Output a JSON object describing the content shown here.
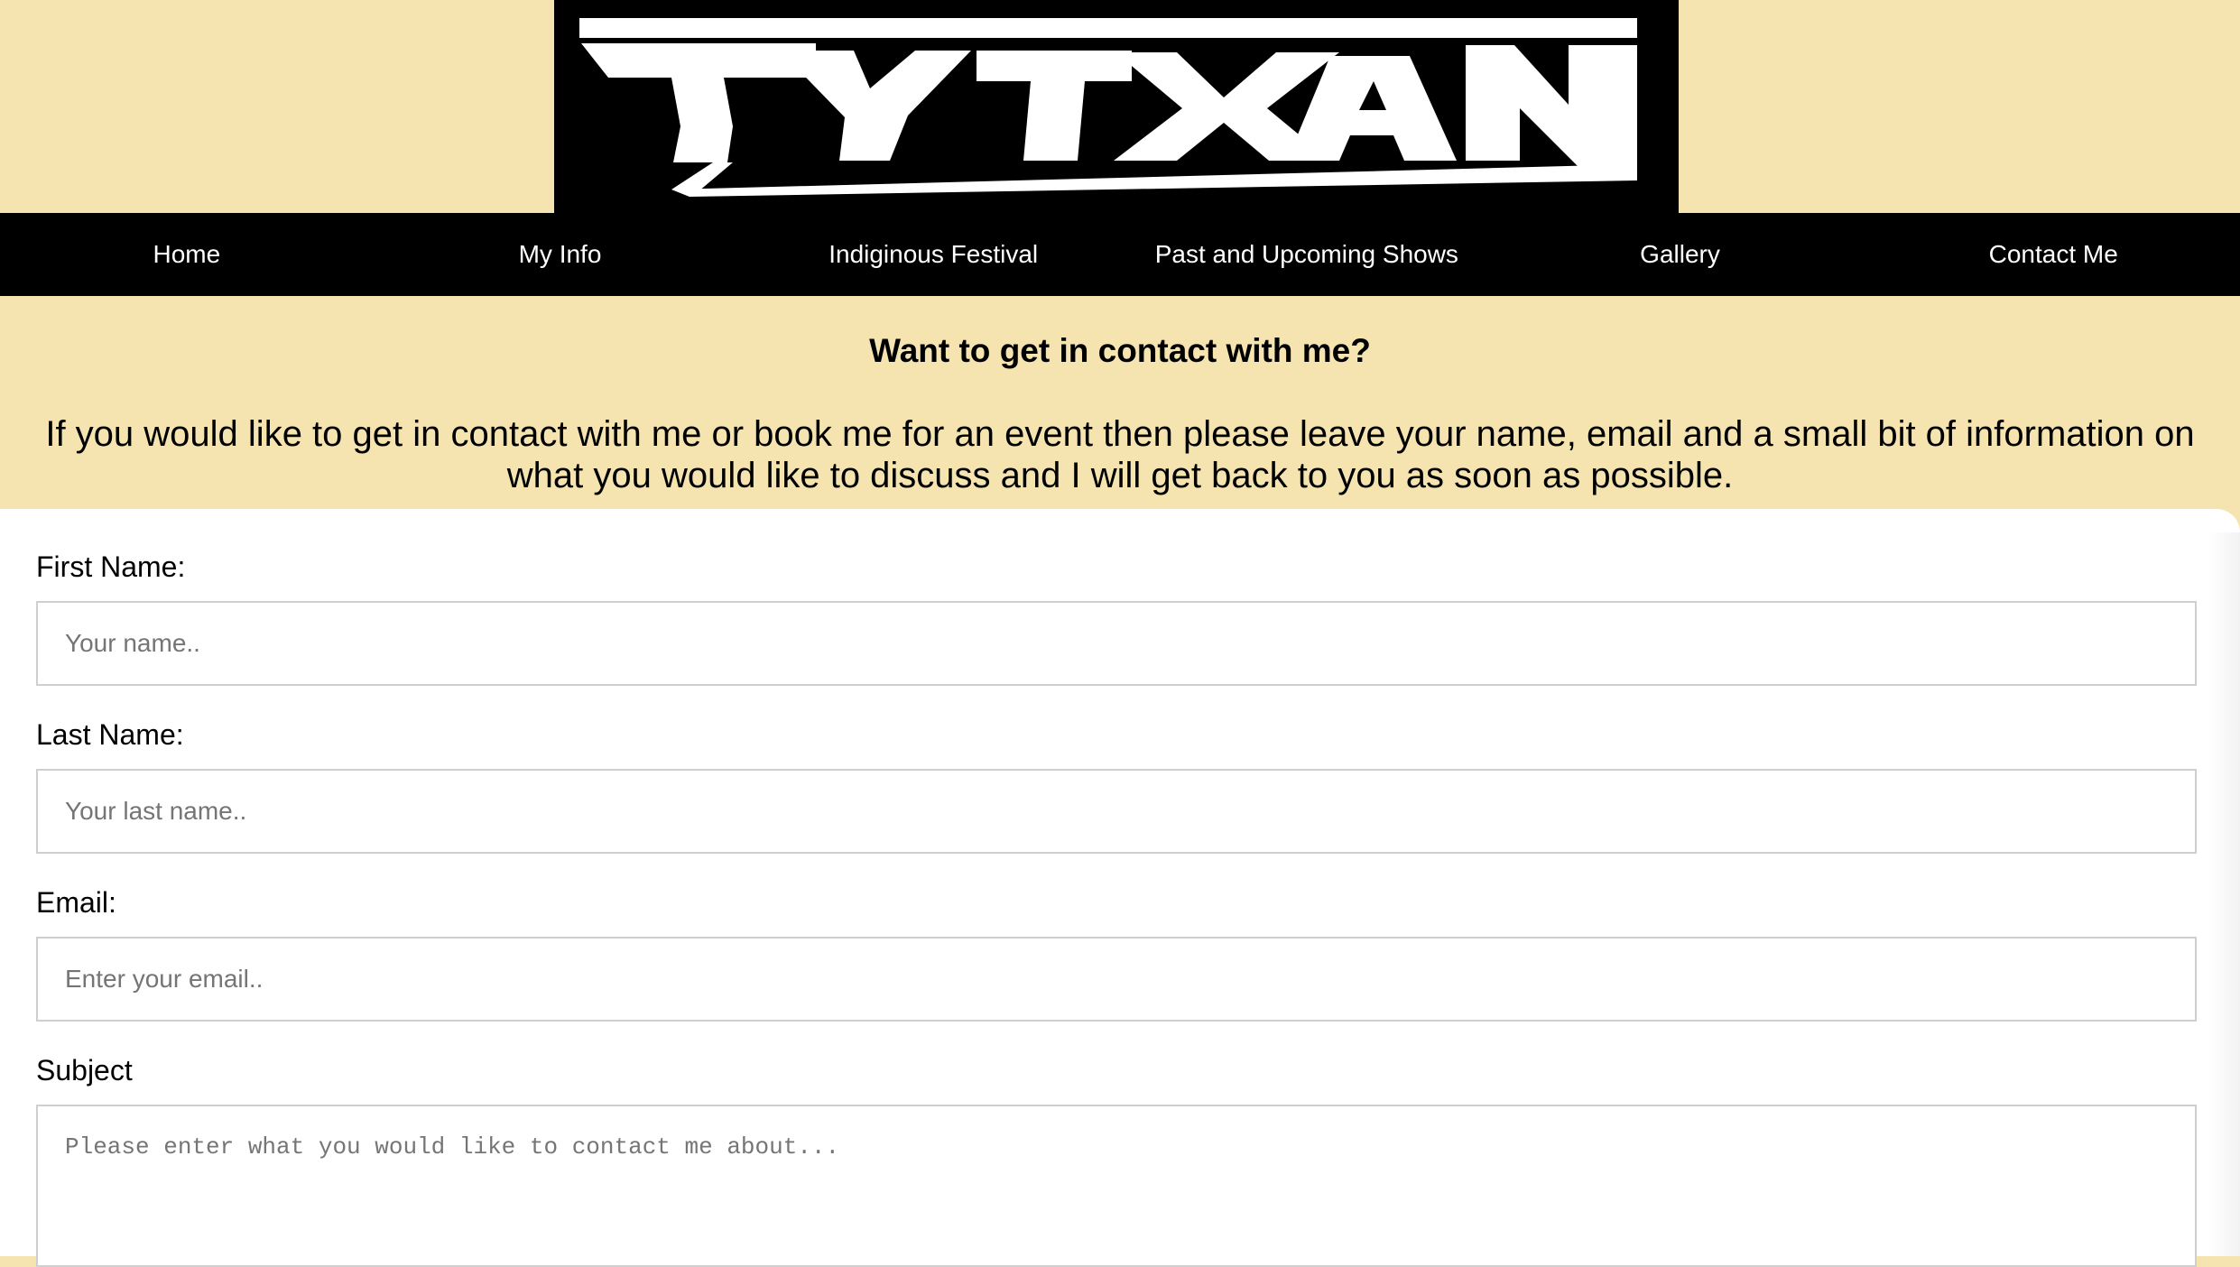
{
  "logo": {
    "text": "TYTXAN",
    "bg_color": "#000000",
    "fg_color": "#ffffff"
  },
  "nav": {
    "items": [
      {
        "label": "Home"
      },
      {
        "label": "My Info"
      },
      {
        "label": "Indiginous Festival"
      },
      {
        "label": "Past and Upcoming Shows"
      },
      {
        "label": "Gallery"
      },
      {
        "label": "Contact Me"
      }
    ]
  },
  "intro": {
    "heading": "Want to get in contact with me?",
    "body": "If you would like to get in contact with me or book me for an event then please leave your name, email and a small bit of information on what you would like to discuss and I will get back to you as soon as possible."
  },
  "form": {
    "first_name": {
      "label": "First Name:",
      "placeholder": "Your name.."
    },
    "last_name": {
      "label": "Last Name:",
      "placeholder": "Your last name.."
    },
    "email": {
      "label": "Email:",
      "placeholder": "Enter your email.."
    },
    "subject": {
      "label": "Subject",
      "placeholder": "Please enter what you would like to contact me about..."
    }
  },
  "colors": {
    "page_bg": "#f5e4b0",
    "nav_bg": "#000000",
    "nav_text": "#ffffff",
    "form_bg": "#ffffff"
  }
}
